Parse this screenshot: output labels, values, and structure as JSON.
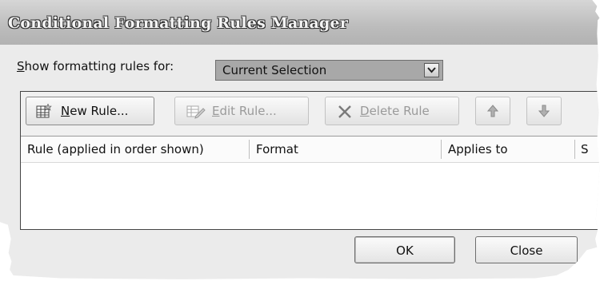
{
  "window": {
    "title": "Conditional Formatting Rules Manager"
  },
  "show_rules": {
    "label_access": "S",
    "label_rest": "how formatting rules for:",
    "selected_value": "Current Selection"
  },
  "toolbar": {
    "new_rule": {
      "access": "N",
      "rest": "ew Rule..."
    },
    "edit_rule": {
      "access": "E",
      "rest": "dit Rule..."
    },
    "delete_rule": {
      "access": "D",
      "rest": "elete Rule"
    }
  },
  "columns": [
    "Rule (applied in order shown)",
    "Format",
    "Applies to",
    "S"
  ],
  "rules": [],
  "buttons": {
    "ok": "OK",
    "close": "Close"
  }
}
